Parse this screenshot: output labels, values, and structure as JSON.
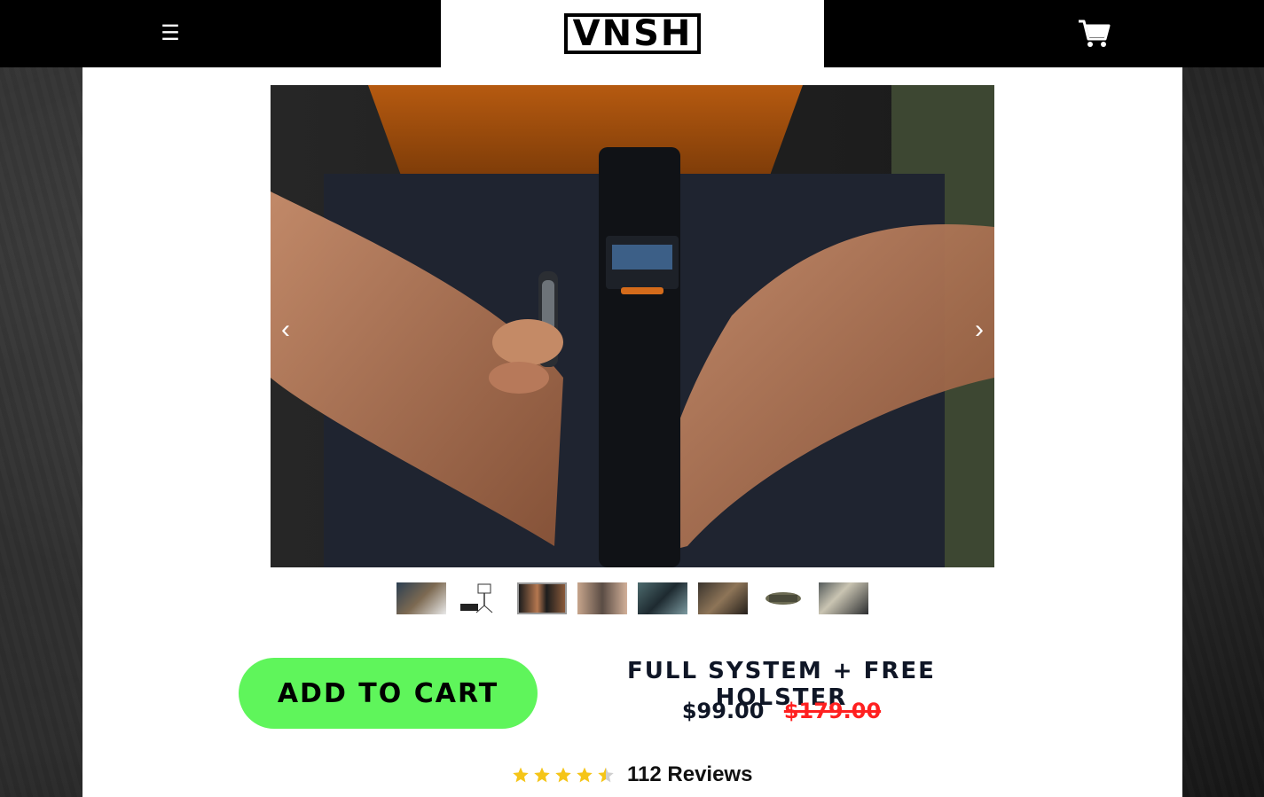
{
  "header": {
    "logo_text": "VNSH",
    "menu_icon": "hamburger-icon",
    "cart_icon": "cart-icon"
  },
  "gallery": {
    "prev_label": "‹",
    "next_label": "›",
    "thumbnail_count": 8,
    "selected_thumbnail": 3
  },
  "product": {
    "add_to_cart_label": "ADD TO CART",
    "title": "FULL SYSTEM + FREE HOLSTER",
    "price": "$99.00",
    "compare_price": "$179.00",
    "rating": 4.5,
    "review_text": "112 Reviews"
  },
  "colors": {
    "cta": "#5ff55b",
    "sale_price": "#ff2020",
    "title": "#0f1626",
    "star": "#f5c518"
  }
}
